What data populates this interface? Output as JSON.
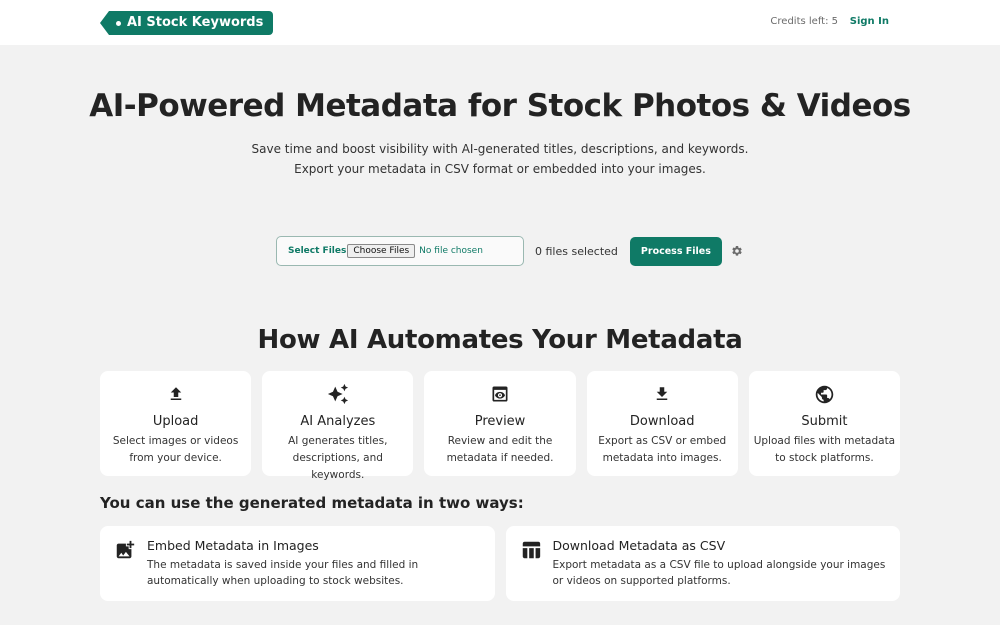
{
  "header": {
    "logo_text": "AI Stock Keywords",
    "credits": "Credits left: 5",
    "signin": "Sign In"
  },
  "hero": {
    "title": "AI-Powered Metadata for Stock Photos & Videos",
    "subtitle_line1": "Save time and boost visibility with AI-generated titles, descriptions, and keywords.",
    "subtitle_line2": "Export your metadata in CSV format or embedded into your images."
  },
  "upload": {
    "select_label": "Select Files",
    "choose_button": "Choose Files",
    "no_file": "No file chosen",
    "files_selected": "0 files selected",
    "process_button": "Process Files"
  },
  "how": {
    "title": "How AI Automates Your Metadata",
    "steps": [
      {
        "icon": "upload-icon",
        "title": "Upload",
        "desc": "Select images or videos from your device."
      },
      {
        "icon": "sparkles-icon",
        "title": "AI Analyzes",
        "desc": "AI generates titles, descriptions, and keywords."
      },
      {
        "icon": "preview-icon",
        "title": "Preview",
        "desc": "Review and edit the metadata if needed."
      },
      {
        "icon": "download-icon",
        "title": "Download",
        "desc": "Export as CSV or embed metadata into images."
      },
      {
        "icon": "globe-icon",
        "title": "Submit",
        "desc": "Upload files with metadata to stock platforms."
      }
    ]
  },
  "ways": {
    "title": "You can use the generated metadata in two ways:",
    "items": [
      {
        "icon": "add-photo-icon",
        "title": "Embed Metadata in Images",
        "desc": "The metadata is saved inside your files and filled in automatically when uploading to stock websites."
      },
      {
        "icon": "table-icon",
        "title": "Download Metadata as CSV",
        "desc": "Export metadata as a CSV file to upload alongside your images or videos on supported platforms."
      }
    ]
  },
  "colors": {
    "brand": "#0f7a66",
    "background": "#f2f2f2",
    "card": "#ffffff"
  }
}
